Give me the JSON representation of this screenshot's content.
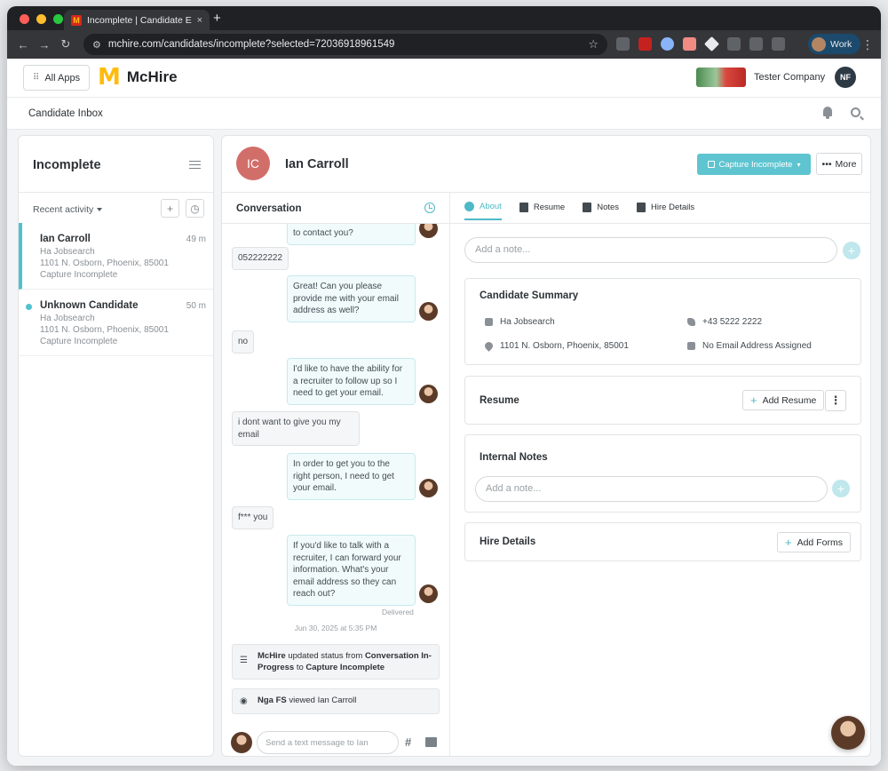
{
  "browser": {
    "tab_title": "Incomplete | Candidate Exper",
    "tab_close": "×",
    "new_tab": "+",
    "url": "mchire.com/candidates/incomplete?selected=72036918961549",
    "profile_label": "Work"
  },
  "header": {
    "all_apps": "All Apps",
    "brand_mark": "M",
    "brand_name": "McHire",
    "company": "Tester Company",
    "user_initials": "NF"
  },
  "subheader": {
    "title": "Candidate Inbox"
  },
  "list_panel": {
    "title": "Incomplete",
    "sort_label": "Recent activity",
    "candidates": [
      {
        "name": "Ian Carroll",
        "time": "49 m",
        "source": "Ha Jobsearch",
        "address": "1101 N. Osborn, Phoenix, 85001",
        "status": "Capture Incomplete"
      },
      {
        "name": "Unknown Candidate",
        "time": "50 m",
        "source": "Ha Jobsearch",
        "address": "1101 N. Osborn, Phoenix, 85001",
        "status": "Capture Incomplete"
      }
    ]
  },
  "candidate": {
    "initials": "IC",
    "name": "Ian Carroll",
    "status_button": "Capture Incomplete",
    "more_button": "More"
  },
  "conversation": {
    "title": "Conversation",
    "messages": [
      {
        "from": "bot",
        "lines": [
          "to contact you?"
        ]
      },
      {
        "from": "user",
        "lines": [
          "052222222"
        ]
      },
      {
        "from": "bot",
        "lines": [
          "Great! Can you please",
          "provide me with your email",
          "address as well?"
        ]
      },
      {
        "from": "user",
        "lines": [
          "no"
        ]
      },
      {
        "from": "bot",
        "lines": [
          "I'd like to have the ability for",
          "a recruiter to follow up so I",
          "need to get your email."
        ]
      },
      {
        "from": "user",
        "lines": [
          "i dont want to give you my",
          "email"
        ]
      },
      {
        "from": "bot",
        "lines": [
          "In order to get you to the",
          "right person, I need to get",
          "your email."
        ]
      },
      {
        "from": "user",
        "lines": [
          "f*** you"
        ]
      },
      {
        "from": "bot",
        "lines": [
          "If you'd like to talk with a",
          "recruiter, I can forward your",
          "information. What's your",
          "email address so they can",
          "reach out?"
        ]
      }
    ],
    "delivered": "Delivered",
    "date": "Jun 30, 2025 at 5:35 PM",
    "system": {
      "actor": "McHire",
      "text": " updated status from ",
      "from_status": "Conversation In-Progress",
      "to_word": " to ",
      "to_status": "Capture Incomplete"
    },
    "viewed": {
      "actor": "Nga FS",
      "text": " viewed Ian Carroll"
    },
    "composer_placeholder": "Send a text message to Ian",
    "hash_icon": "#"
  },
  "about": {
    "tabs": [
      "About",
      "Resume",
      "Notes",
      "Hire Details"
    ],
    "note_placeholder": "Add a note...",
    "summary": {
      "title": "Candidate Summary",
      "source": "Ha Jobsearch",
      "phone": "+43 5222 2222",
      "address": "1101 N. Osborn, Phoenix, 85001",
      "email": "No Email Address Assigned"
    },
    "resume": {
      "title": "Resume",
      "add_button": "Add Resume",
      "kebab": "⋮"
    },
    "internal_notes": {
      "title": "Internal Notes",
      "placeholder": "Add a note..."
    },
    "hire_details": {
      "title": "Hire Details",
      "add_button": "Add Forms"
    }
  },
  "colors": {
    "accent": "#4fc1cf",
    "button": "#5ec4d0",
    "avatar": "#d26e6a",
    "brand_yellow": "#ffbc0d"
  }
}
